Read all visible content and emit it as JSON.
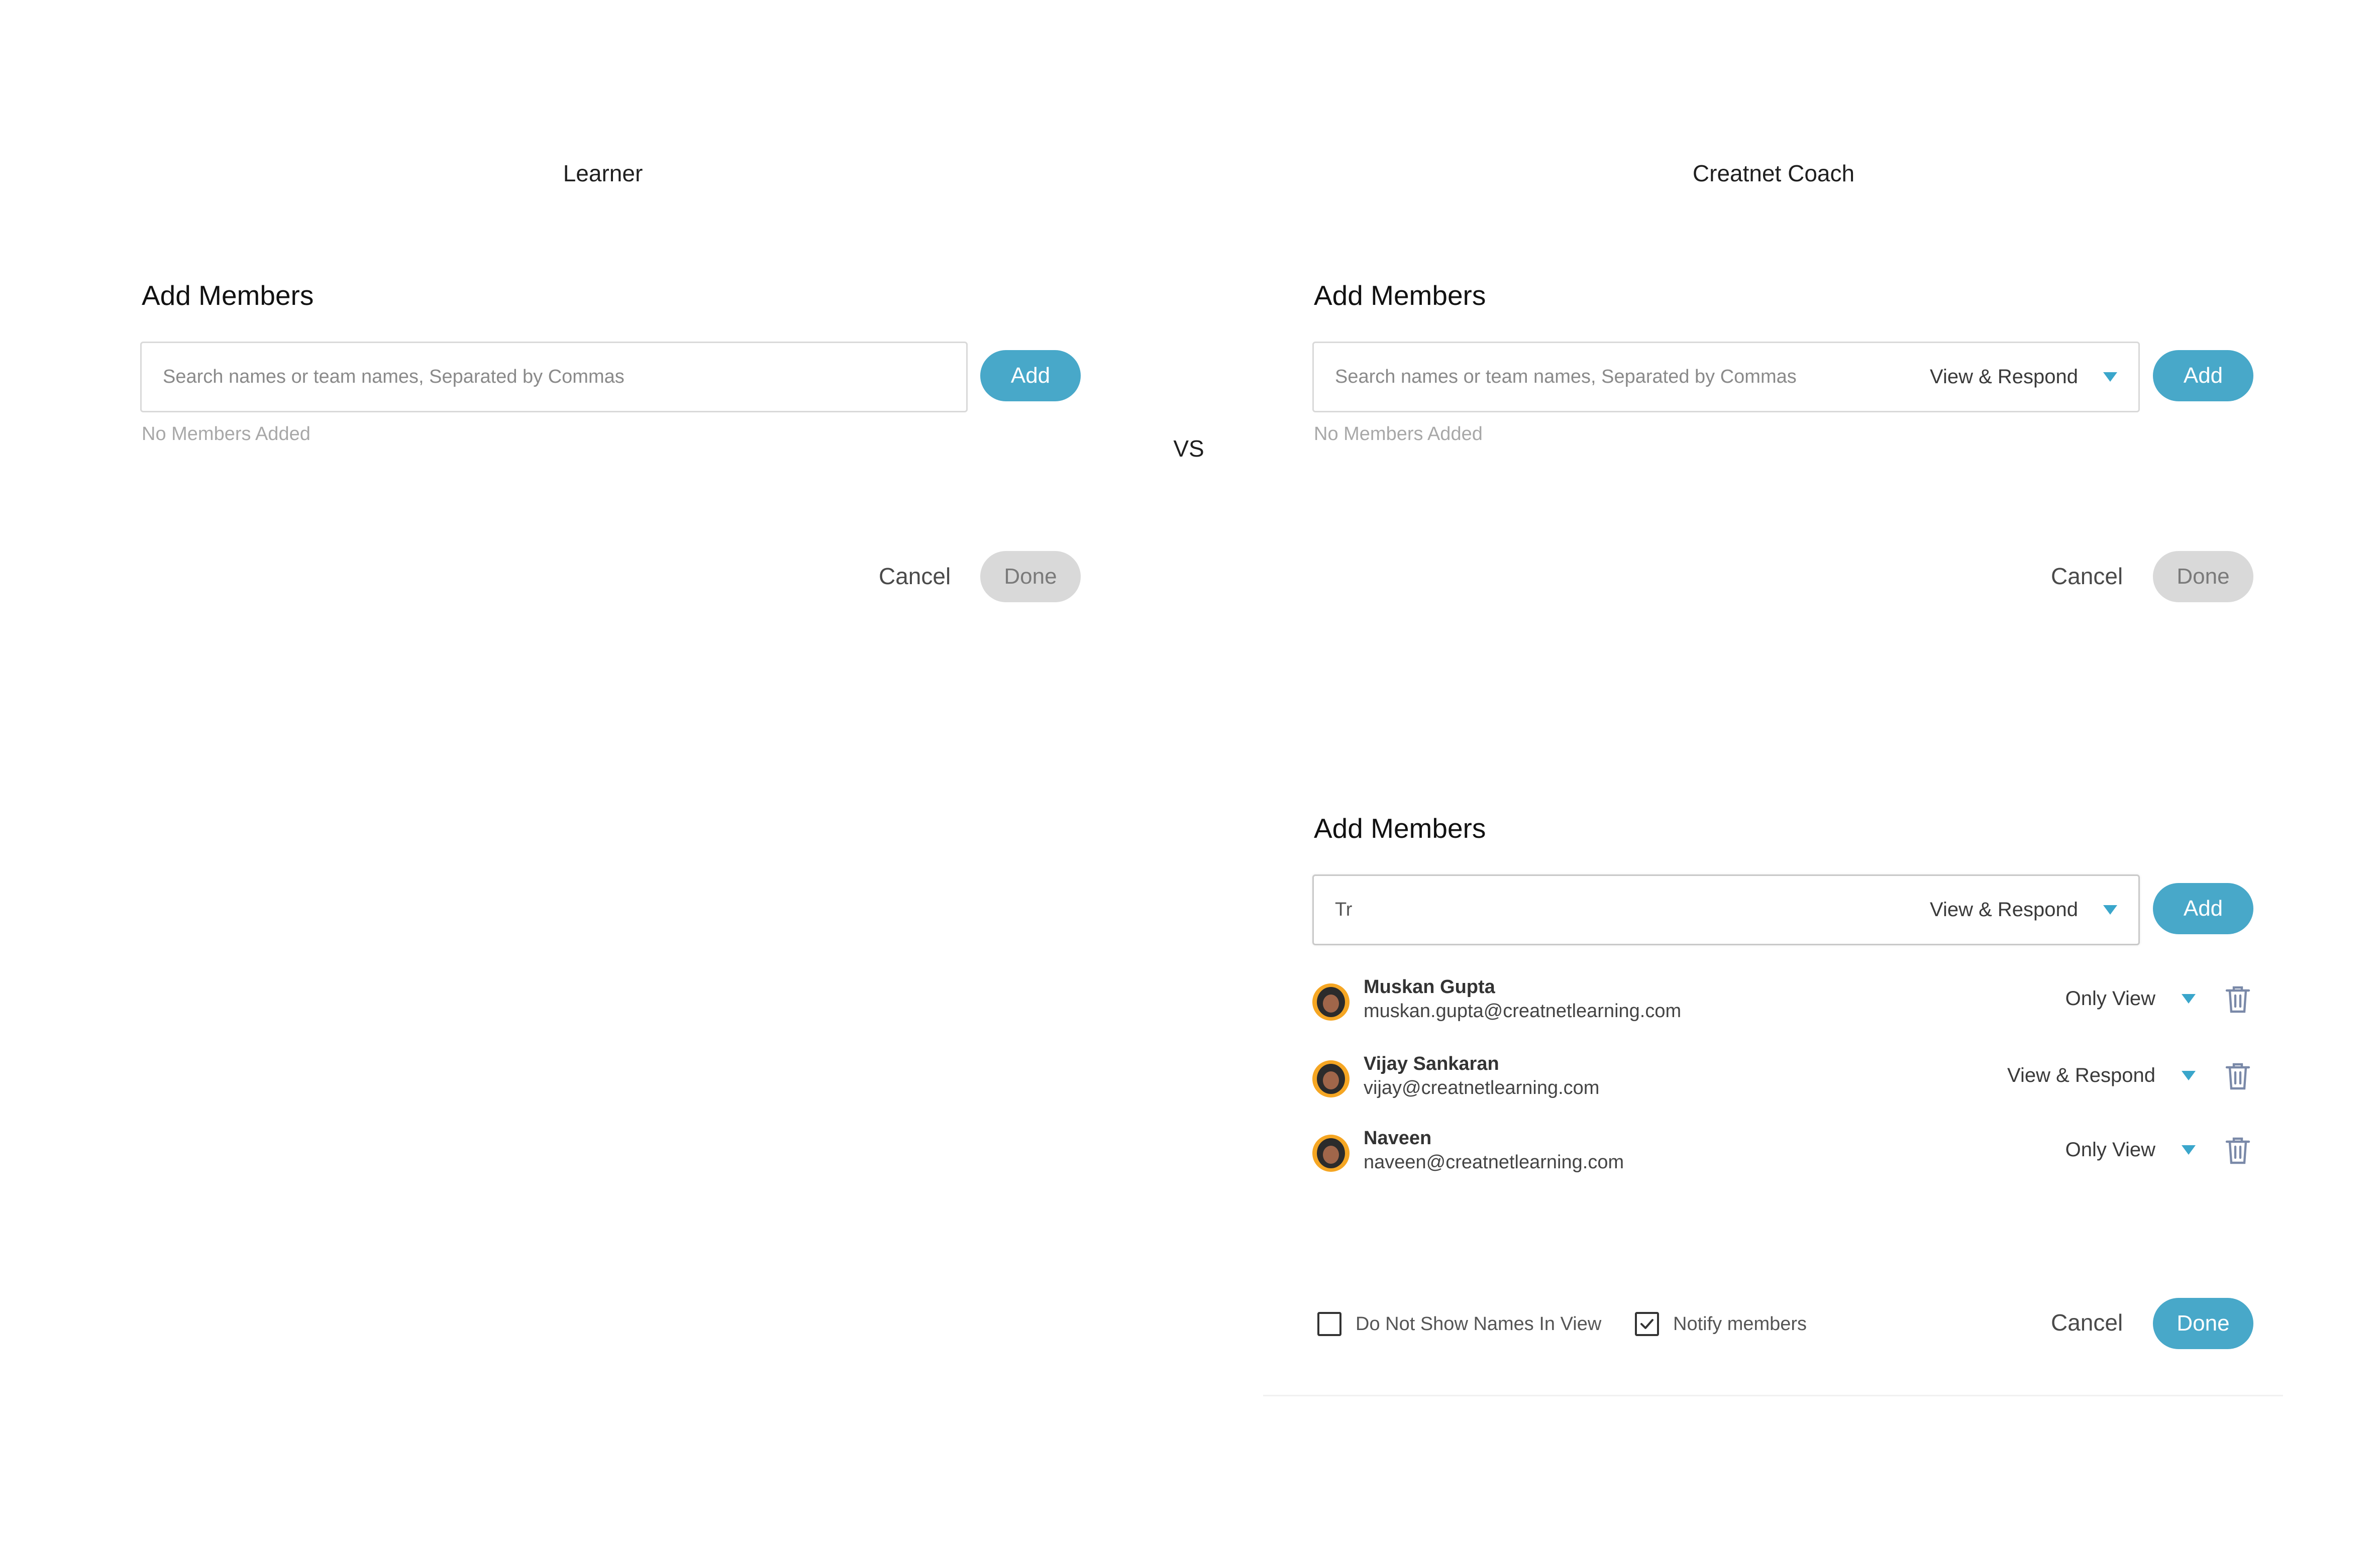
{
  "columns": {
    "left_title": "Learner",
    "right_title": "Creatnet Coach",
    "vs_label": "VS"
  },
  "learner_panel": {
    "title": "Add Members",
    "search_placeholder": "Search names or team names, Separated by Commas",
    "add_label": "Add",
    "empty_note": "No Members Added",
    "cancel_label": "Cancel",
    "done_label": "Done"
  },
  "coach_panel_empty": {
    "title": "Add Members",
    "search_placeholder": "Search names or team names, Separated by Commas",
    "permission": "View & Respond",
    "add_label": "Add",
    "empty_note": "No Members Added",
    "cancel_label": "Cancel",
    "done_label": "Done"
  },
  "coach_panel_filled": {
    "title": "Add Members",
    "search_value": "Tr",
    "permission": "View & Respond",
    "add_label": "Add",
    "members": [
      {
        "name": "Muskan Gupta",
        "email": "muskan.gupta@creatnetlearning.com",
        "permission": "Only View"
      },
      {
        "name": "Vijay Sankaran",
        "email": "vijay@creatnetlearning.com",
        "permission": "View & Respond"
      },
      {
        "name": "Naveen",
        "email": "naveen@creatnetlearning.com",
        "permission": "Only View"
      }
    ],
    "hide_names_label": "Do Not Show Names In View",
    "hide_names_checked": false,
    "notify_label": "Notify members",
    "notify_checked": true,
    "cancel_label": "Cancel",
    "done_label": "Done"
  },
  "colors": {
    "accent": "#48a8c9",
    "caret": "#3aa6cb",
    "disabled_button": "#d9d9d9",
    "trash_icon": "#7a89a8"
  },
  "icons": [
    "caret-down-icon",
    "trash-icon",
    "avatar",
    "checkbox",
    "check-icon"
  ]
}
